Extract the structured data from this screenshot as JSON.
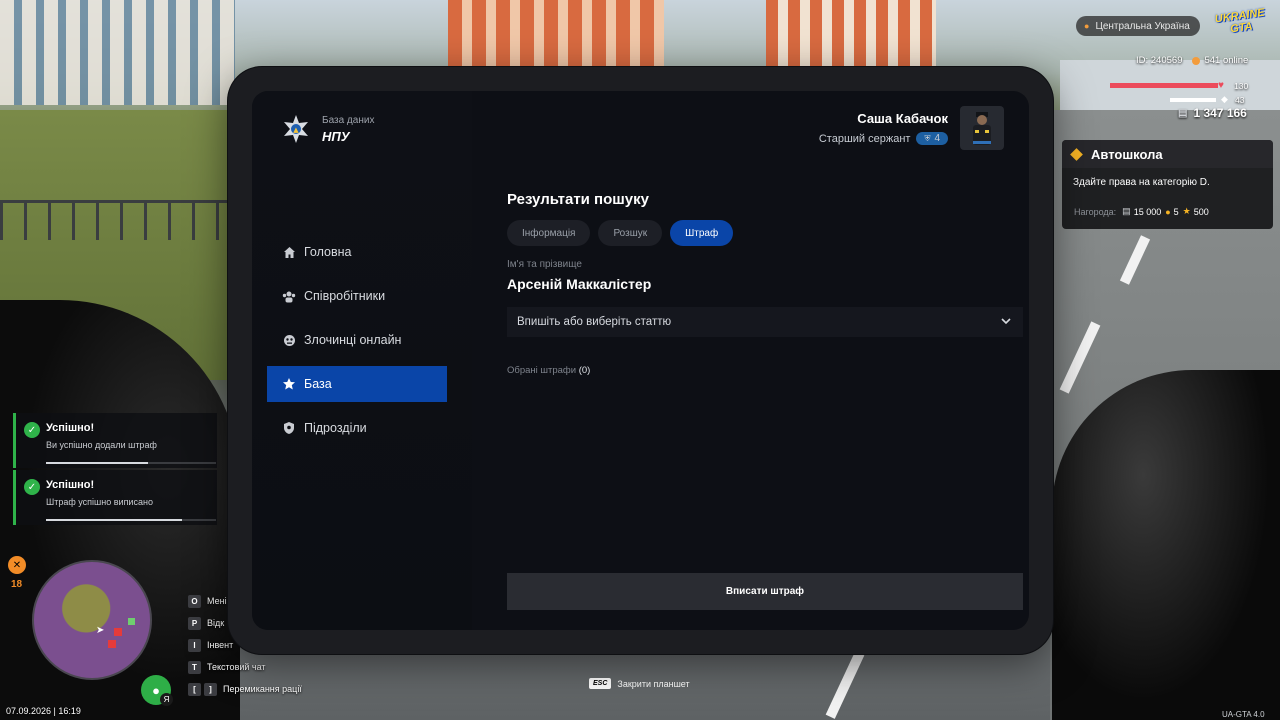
{
  "tablet": {
    "brand": {
      "subtitle": "База даних",
      "title": "НПУ"
    },
    "user": {
      "name": "Саша Кабачок",
      "rank": "Старший сержант",
      "rank_level": "4"
    },
    "nav": [
      {
        "label": "Головна",
        "icon": "home-icon"
      },
      {
        "label": "Співробітники",
        "icon": "people-icon"
      },
      {
        "label": "Злочинці онлайн",
        "icon": "mask-icon"
      },
      {
        "label": "База",
        "icon": "star-icon",
        "active": true
      },
      {
        "label": "Підрозділи",
        "icon": "shield-icon"
      }
    ],
    "main": {
      "title": "Результати пошуку",
      "tabs": [
        {
          "label": "Інформація"
        },
        {
          "label": "Розшук"
        },
        {
          "label": "Штраф",
          "active": true
        }
      ],
      "name_label": "Ім'я та прізвище",
      "name_value": "Арсеній Маккалістер",
      "article_select_placeholder": "Впишіть або виберіть статтю",
      "selected_fines_label": "Обрані штрафи",
      "selected_fines_count": "(0)",
      "submit_label": "Вписати штраф"
    }
  },
  "hud": {
    "region": "Центральна Україна",
    "logo_line1": "UKRAINE",
    "logo_line2": "GTA",
    "player_id": "ID: 240569",
    "online": "541 online",
    "health": "130",
    "armor": "43",
    "money": "1 347 166",
    "quest": {
      "title": "Автошкола",
      "description": "Здайте права на категорію D.",
      "reward_label": "Нагорода:",
      "reward_money": "15 000",
      "reward_coins": "5",
      "reward_stars": "500"
    },
    "toasts": [
      {
        "title": "Успішно!",
        "message": "Ви успішно додали штраф",
        "progress": 0.6
      },
      {
        "title": "Успішно!",
        "message": "Штраф успішно виписано",
        "progress": 0.8
      }
    ],
    "hunger_value": "18",
    "datetime": "07.09.2026 | 16:19",
    "mic_key": "Я",
    "keybinds": [
      {
        "keys": [
          "O"
        ],
        "label": "Мені"
      },
      {
        "keys": [
          "P"
        ],
        "label": "Відк"
      },
      {
        "keys": [
          "I"
        ],
        "label": "Інвент"
      },
      {
        "keys": [
          "T"
        ],
        "label": "Текстовий чат"
      },
      {
        "keys": [
          "[",
          "]"
        ],
        "label": "Перемикання рації"
      }
    ],
    "esc_key": "ESC",
    "esc_label": "Закрити планшет",
    "version": "UA-GTA 4.0"
  },
  "colors": {
    "accent": "#0a45a8",
    "success": "#2fb34a",
    "health": "#ec4b5b",
    "quest": "#f5b324"
  }
}
